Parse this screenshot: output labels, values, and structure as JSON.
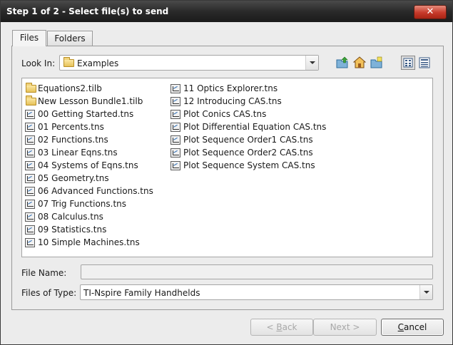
{
  "window": {
    "title": "Step 1 of 2 - Select file(s) to send",
    "close_label": "✕"
  },
  "tabs": [
    {
      "label": "Files",
      "active": true
    },
    {
      "label": "Folders",
      "active": false
    }
  ],
  "look_in": {
    "label": "Look In:",
    "value": "Examples"
  },
  "toolbar_icons": [
    "up-one-level-icon",
    "home-icon",
    "new-folder-icon",
    "list-view-icon",
    "details-view-icon"
  ],
  "files": {
    "column1": [
      {
        "name": "Equations2.tilb",
        "type": "folder"
      },
      {
        "name": "New Lesson Bundle1.tilb",
        "type": "folder"
      },
      {
        "name": "00 Getting Started.tns",
        "type": "tns"
      },
      {
        "name": "01 Percents.tns",
        "type": "tns"
      },
      {
        "name": "02 Functions.tns",
        "type": "tns"
      },
      {
        "name": "03 Linear Eqns.tns",
        "type": "tns"
      },
      {
        "name": "04 Systems of Eqns.tns",
        "type": "tns"
      },
      {
        "name": "05 Geometry.tns",
        "type": "tns"
      },
      {
        "name": "06 Advanced Functions.tns",
        "type": "tns"
      },
      {
        "name": "07 Trig Functions.tns",
        "type": "tns"
      },
      {
        "name": "08 Calculus.tns",
        "type": "tns"
      },
      {
        "name": "09 Statistics.tns",
        "type": "tns"
      },
      {
        "name": "10 Simple Machines.tns",
        "type": "tns"
      }
    ],
    "column2": [
      {
        "name": "11 Optics Explorer.tns",
        "type": "tns"
      },
      {
        "name": "12 Introducing CAS.tns",
        "type": "tns"
      },
      {
        "name": "Plot Conics CAS.tns",
        "type": "tns"
      },
      {
        "name": "Plot Differential Equation CAS.tns",
        "type": "tns"
      },
      {
        "name": "Plot Sequence Order1 CAS.tns",
        "type": "tns"
      },
      {
        "name": "Plot Sequence Order2 CAS.tns",
        "type": "tns"
      },
      {
        "name": "Plot Sequence System CAS.tns",
        "type": "tns"
      }
    ]
  },
  "file_name": {
    "label": "File Name:",
    "value": ""
  },
  "files_of_type": {
    "label": "Files of Type:",
    "value": "TI-Nspire Family Handhelds"
  },
  "buttons": {
    "back_arrow": "< ",
    "back_mnemonic": "B",
    "back_rest": "ack",
    "next_label": "Next >",
    "cancel_mnemonic": "C",
    "cancel_rest": "ancel"
  },
  "colors": {
    "titlebar": "#2a2a2a",
    "close_button": "#c7392a",
    "folder": "#e6c25a"
  }
}
